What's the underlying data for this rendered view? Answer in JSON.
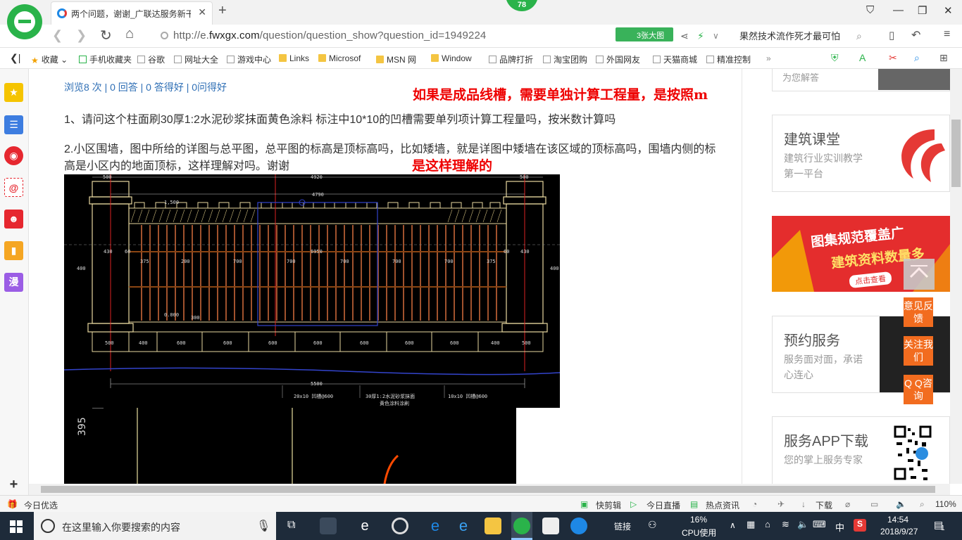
{
  "browser": {
    "tab_title": "两个问题，谢谢_广联达服务新干",
    "badge_count": "78",
    "url_prefix": "http://e.",
    "url_domain": "fwxgx.com",
    "url_path": "/question/question_show?question_id=1949224",
    "big_pic_label": "3张大图",
    "search_text": "果然技术流作死才最可怕"
  },
  "bookmarks": [
    {
      "label": "收藏",
      "icon": "star-icon"
    },
    {
      "label": "手机收藏夹",
      "icon": "phone-icon"
    },
    {
      "label": "谷歌",
      "icon": "page-icon"
    },
    {
      "label": "网址大全",
      "icon": "page-icon"
    },
    {
      "label": "游戏中心",
      "icon": "page-icon"
    },
    {
      "label": "Links",
      "icon": "folder-icon"
    },
    {
      "label": "Microsof",
      "icon": "folder-icon"
    },
    {
      "label": "MSN 网",
      "icon": "folder-icon"
    },
    {
      "label": "Window",
      "icon": "folder-icon"
    },
    {
      "label": "品牌打折",
      "icon": "page-icon"
    },
    {
      "label": "淘宝团购",
      "icon": "page-icon"
    },
    {
      "label": "外国网友",
      "icon": "page-icon"
    },
    {
      "label": "天猫商城",
      "icon": "page-icon"
    },
    {
      "label": "精准控制",
      "icon": "page-icon"
    }
  ],
  "page": {
    "meta": "浏览8 次 | 0 回答 | 0 答得好 | 0问得好",
    "note_top": "如果是成品线槽，需要单独计算工程量，是按照m",
    "question_1": "1、请问这个柱面刷30厚1:2水泥砂浆抹面黄色涂料   标注中10*10的凹槽需要单列项计算工程量吗，按米数计算吗",
    "question_2": "2.小区围墙，图中所给的详图与总平图，总平图的标高是顶标高吗，比如矮墙，就是详图中矮墙在该区域的顶标高吗，围墙内侧的标高是小区内的地面顶标，这样理解对吗。谢谢",
    "note_bottom": "是这样理解的"
  },
  "cad": {
    "dims_top": [
      "500",
      "4920",
      "500",
      "4790",
      "1,500"
    ],
    "dims_mid": [
      "430",
      "60",
      "6950",
      "60",
      "430",
      "375",
      "200",
      "700",
      "700",
      "700",
      "700",
      "700",
      "375",
      "400",
      "400",
      "0.000",
      "300"
    ],
    "dims_bottom": [
      "500",
      "400",
      "600",
      "600",
      "600",
      "600",
      "600",
      "600",
      "600",
      "400",
      "500"
    ],
    "total": "5500",
    "labels": [
      "20x10 凹槽@600",
      "30厚1:2水泥砂浆抹面",
      "黄色涂料涂刷",
      "10x10 凹槽@600"
    ],
    "lower_dim": "395"
  },
  "sidebar_right": {
    "top_card_sub": "为您解答",
    "card1_title": "建筑课堂",
    "card1_sub": "建筑行业实训教学第一平台",
    "promo_line1": "图集规范覆盖广",
    "promo_line2": "建筑资料数量多",
    "promo_button": "点击查看",
    "card2_title": "预约服务",
    "card2_sub": "服务面对面，承诺心连心",
    "card3_title": "服务APP下载",
    "card3_sub": "您的掌上服务专家",
    "float_feedback": "意见反馈",
    "float_follow": "关注我们",
    "float_qq": "Q Q咨询"
  },
  "statusbar": {
    "left": "今日优选",
    "items": [
      "快剪辑",
      "今日直播",
      "热点资讯",
      "下载"
    ],
    "zoom": "110%"
  },
  "taskbar": {
    "search_placeholder": "在这里输入你要搜索的内容",
    "link_label": "链接",
    "cpu_percent": "16%",
    "cpu_label": "CPU使用",
    "ime": "中",
    "time": "14:54",
    "date": "2018/9/27",
    "notif_count": "1"
  },
  "colors": {
    "brand_green": "#2ab34a",
    "link_blue": "#2f6fb5",
    "note_red": "#e00000",
    "float_orange": "#f26c1f",
    "cad_bg": "#000000"
  }
}
